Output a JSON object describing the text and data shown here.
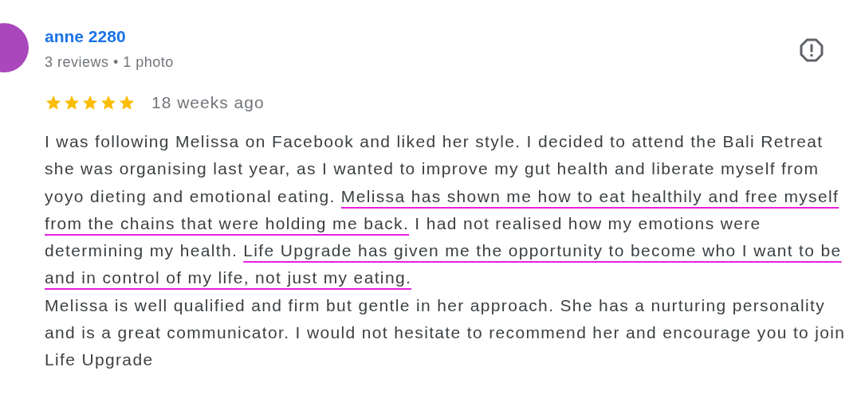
{
  "review": {
    "author": "anne 2280",
    "meta": "3 reviews • 1 photo",
    "stars": 5,
    "time": "18 weeks ago",
    "paragraphs": [
      {
        "segments": [
          {
            "text": "I was following Melissa on Facebook and liked her style. I decided to attend the Bali Retreat she was organising last year, as I wanted to improve my gut health and liberate myself from yoyo dieting and emotional eating. ",
            "underlined": false
          },
          {
            "text": "Melissa has shown me how to eat healthily and free myself from the chains that were holding me back.",
            "underlined": true
          },
          {
            "text": " I had not realised how my emotions were determining my health. ",
            "underlined": false
          },
          {
            "text": "Life Upgrade has given me the opportunity to become who I want to be and in control of my life, not just my eating.",
            "underlined": true
          }
        ]
      },
      {
        "segments": [
          {
            "text": "Melissa is well qualified and firm but gentle in her approach. She has a nurturing personality and is a great communicator. I would not hesitate to recommend her and encourage you to join Life Upgrade",
            "underlined": false
          }
        ]
      }
    ]
  }
}
